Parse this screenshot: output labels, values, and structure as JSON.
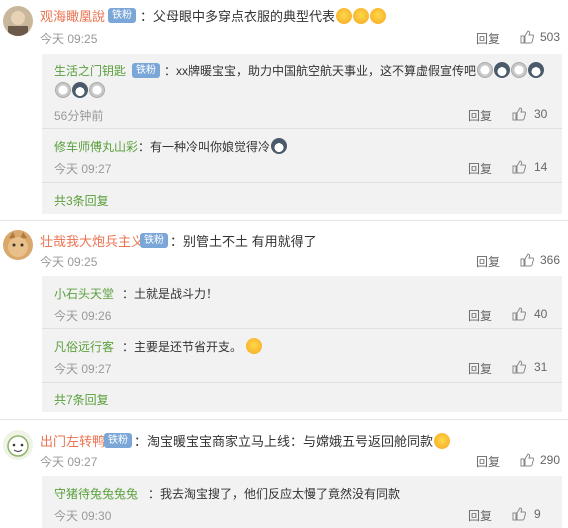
{
  "comments": [
    {
      "username": "观海瞰凰說",
      "badge": "铁粉",
      "text": "父母眼中多穿点衣服的典型代表",
      "time": "今天 09:25",
      "reply_label": "回复",
      "likes": "503"
    },
    {
      "username": "壮哉我大炮兵主义",
      "badge": "铁粉",
      "text": "别管土不土 有用就得了",
      "time": "今天 09:25",
      "reply_label": "回复",
      "likes": "366"
    },
    {
      "username": "出门左转鸭",
      "badge": "铁粉",
      "text": "淘宝暖宝宝商家立马上线：与嫦娥五号返回舱同款",
      "time": "今天 09:27",
      "reply_label": "回复",
      "likes": "290"
    }
  ],
  "replies_thread1": [
    {
      "username": "生活之门钥匙",
      "badge": "铁粉",
      "text": "：xx牌暖宝宝，助力中国航空航天事业，这不算虚假宣传吧",
      "time": "56分钟前",
      "reply_label": "回复",
      "likes": "30"
    },
    {
      "username": "修车师傅丸山彩",
      "text": "：有一种冷叫你娘觉得冷",
      "time": "今天 09:27",
      "reply_label": "回复",
      "likes": "14"
    }
  ],
  "more_thread1": "共3条回复",
  "replies_thread2": [
    {
      "username": "小石头天堂",
      "text": "：土就是战斗力！",
      "time": "今天 09:26",
      "reply_label": "回复",
      "likes": "40"
    },
    {
      "username": "凡俗远行客",
      "text": "：主要是还节省开支。",
      "time": "今天 09:27",
      "reply_label": "回复",
      "likes": "31"
    }
  ],
  "more_thread2": "共7条回复",
  "replies_thread3": [
    {
      "username": "守猪待兔兔兔兔",
      "text": "：我去淘宝搜了，他们反应太慢了竟然没有同款",
      "time": "今天 09:30",
      "reply_label": "回复",
      "likes": "9"
    }
  ],
  "colors": {
    "username": "#eb7350",
    "reply_username": "#5aa03c",
    "badge": "#7ba6d8",
    "reply_box": "#f2f2f2"
  },
  "icons": [
    "thumbs-up-icon",
    "smile-emoji-icon",
    "cat-emoji-icon",
    "husky-emoji-icon"
  ]
}
